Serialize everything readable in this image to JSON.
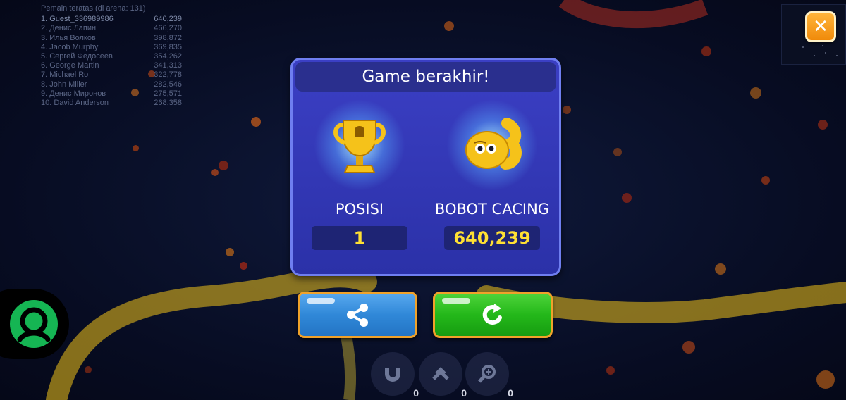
{
  "leaderboard": {
    "title": "Pemain teratas (di arena: 131)",
    "rows": [
      {
        "name": "1. Guest_336989986",
        "score": "640,239"
      },
      {
        "name": "2. Денис Лапин",
        "score": "466,270"
      },
      {
        "name": "3. Илья Волков",
        "score": "398,872"
      },
      {
        "name": "4. Jacob Murphy",
        "score": "369,835"
      },
      {
        "name": "5. Сергей Федосеев",
        "score": "354,262"
      },
      {
        "name": "6. George Martin",
        "score": "341,313"
      },
      {
        "name": "7. Michael Ro",
        "score": "322,778"
      },
      {
        "name": "8. John Miller",
        "score": "282,546"
      },
      {
        "name": "9. Денис Миронов",
        "score": "275,571"
      },
      {
        "name": "10. David Anderson",
        "score": "268,358"
      }
    ]
  },
  "modal": {
    "title": "Game berakhir!",
    "position_label": "POSISI",
    "position_value": "1",
    "weight_label": "BOBOT CACING",
    "weight_value": "640,239"
  },
  "powerups": [
    {
      "icon": "magnet-icon",
      "count": "0"
    },
    {
      "icon": "speed-arrow-icon",
      "count": "0"
    },
    {
      "icon": "magnifier-icon",
      "count": "0"
    }
  ],
  "icons": {
    "close": "close-icon",
    "share": "share-icon",
    "replay": "replay-icon",
    "trophy": "trophy-icon",
    "worm": "worm-icon",
    "avatar": "user-avatar-icon"
  },
  "colors": {
    "modal_bg": "#3b3fc4",
    "value_text": "#ffe033",
    "share_button": "#3088d8",
    "replay_button": "#24b81a",
    "close_button": "#f5a020",
    "avatar_button": "#15b553"
  }
}
